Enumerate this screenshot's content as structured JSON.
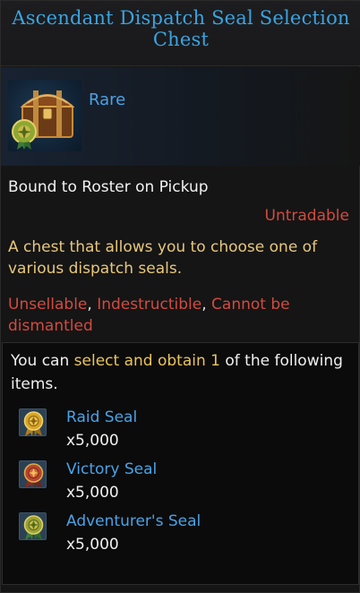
{
  "item": {
    "title_line1": "Ascendant Dispatch Seal Selection",
    "title_line2": "Chest",
    "rarity": "Rare",
    "icon": "treasure-chest-icon",
    "bound": "Bound to Roster on Pickup",
    "trade_status": "Untradable",
    "description": "A chest that allows you to choose one of various dispatch seals.",
    "flags": [
      "Unsellable",
      "Indestructible",
      "Cannot be dismantled"
    ],
    "flag_separator": ","
  },
  "selection": {
    "prefix": "You can",
    "highlight_action": "select and obtain",
    "count": "1",
    "suffix": "of the following items."
  },
  "rewards": [
    {
      "name": "Raid Seal",
      "quantity": "x5,000",
      "icon": "gold-seal-icon",
      "color": "#d7a42a"
    },
    {
      "name": "Victory Seal",
      "quantity": "x5,000",
      "icon": "red-seal-icon",
      "color": "#b8442e"
    },
    {
      "name": "Adventurer's Seal",
      "quantity": "x5,000",
      "icon": "green-seal-icon",
      "color": "#9aa236"
    }
  ],
  "colors": {
    "title": "#3aa4e2",
    "rare": "#4aa3e6",
    "untradable": "#d24b3f",
    "description": "#e7c77c",
    "highlight": "#e9c55b"
  }
}
